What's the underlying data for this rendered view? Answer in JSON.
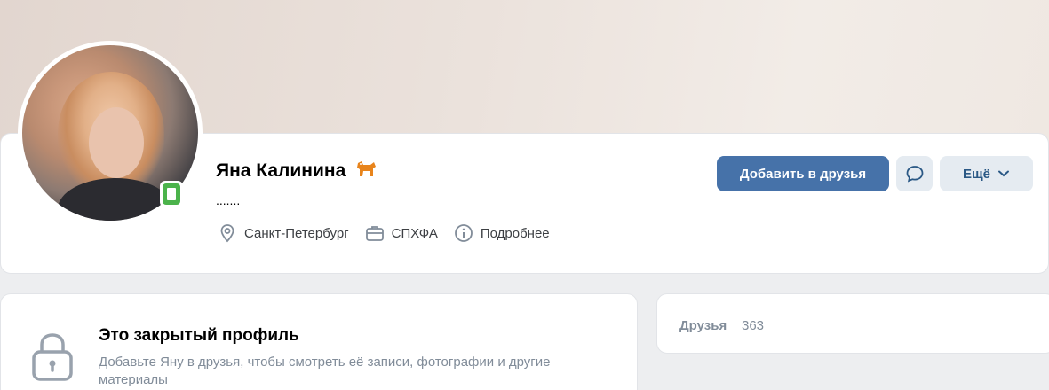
{
  "profile": {
    "name": "Яна Калинина",
    "status": ".......",
    "info": [
      {
        "icon": "location-pin-icon",
        "label": "Санкт-Петербург"
      },
      {
        "icon": "briefcase-icon",
        "label": "СПХФА"
      },
      {
        "icon": "info-circle-icon",
        "label": "Подробнее"
      }
    ],
    "badge_icon": "dog-icon",
    "online_icon": "mobile-online-icon"
  },
  "actions": {
    "add_friend": "Добавить в друзья",
    "message_icon": "message-bubble-icon",
    "more": "Ещё"
  },
  "private": {
    "title": "Это закрытый профиль",
    "text": "Добавьте Яну в друзья, чтобы смотреть её записи, фотографии и другие материалы"
  },
  "friends": {
    "label": "Друзья",
    "count": "363"
  },
  "colors": {
    "accent": "#4672a9",
    "secondary_button": "#e5ebf1",
    "muted_text": "#818c99",
    "online": "#4bb34b",
    "background": "#edeef0"
  }
}
